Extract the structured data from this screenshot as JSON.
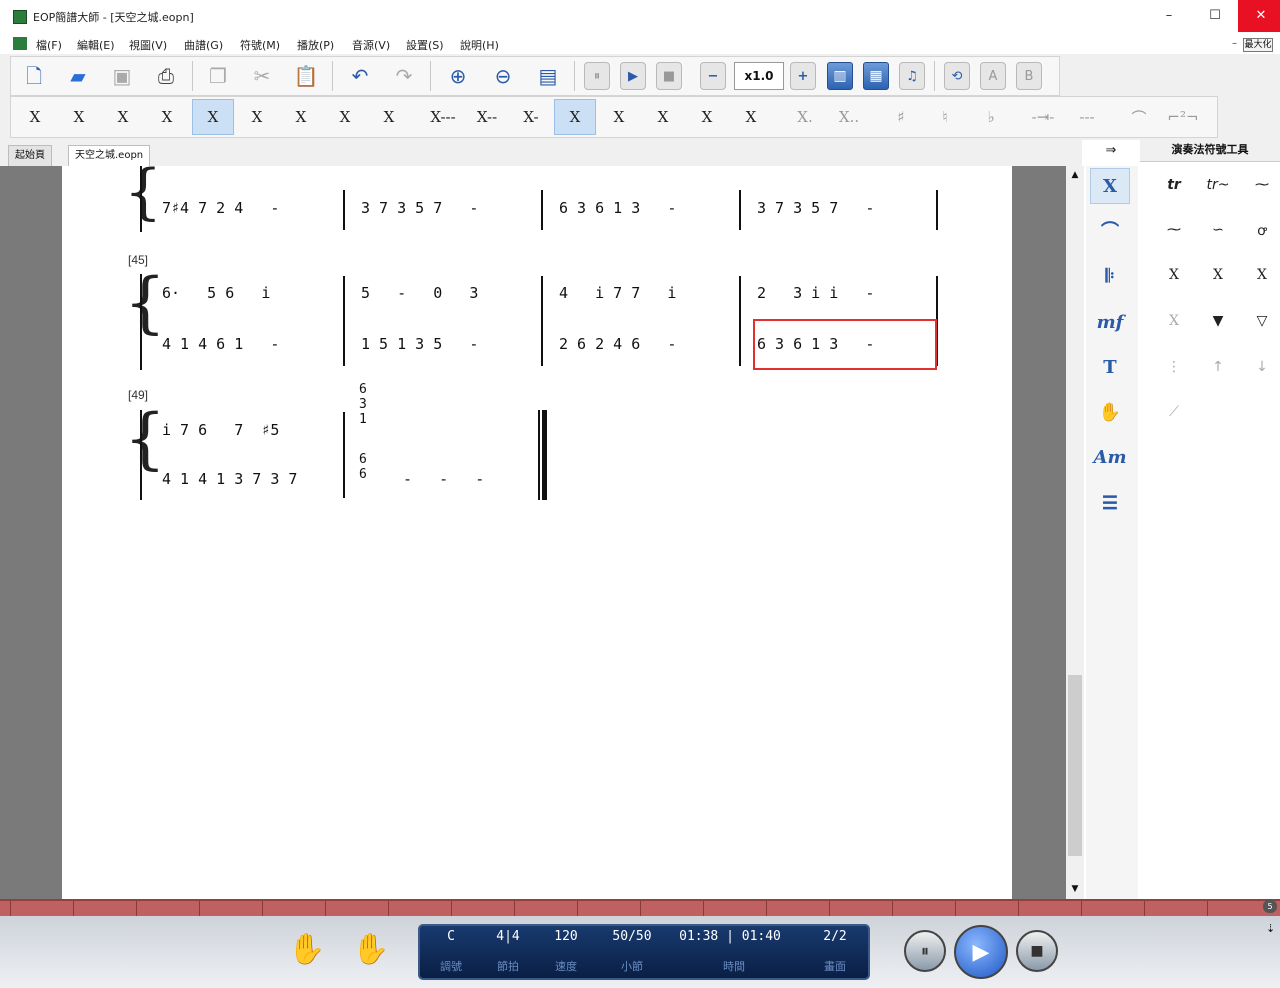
{
  "window": {
    "title": "EOP簡譜大師 - [天空之城.eopn]",
    "minimize": "–",
    "maximize": "☐",
    "close": "✕"
  },
  "menu": {
    "items": [
      "檔(F)",
      "編輯(E)",
      "視圖(V)",
      "曲譜(G)",
      "符號(M)",
      "播放(P)",
      "音源(V)",
      "設置(S)",
      "說明(H)"
    ],
    "mdi_max_label": "最大化"
  },
  "toolbar": {
    "speed": "x1.0",
    "minus": "−",
    "plus": "+",
    "letter_a": "A",
    "letter_b": "B"
  },
  "notetoolbar": {
    "items": [
      "X",
      "X",
      "X",
      "X",
      "X",
      "X",
      "X",
      "X",
      "X",
      "X---",
      "X--",
      "X-",
      "X",
      "X",
      "X",
      "X",
      "X",
      "X.",
      "X..",
      "♯",
      "♮",
      "♭",
      "-⇥-",
      "---",
      "⌒",
      "⌐²¬"
    ]
  },
  "tabs": [
    {
      "label": "起始頁"
    },
    {
      "label": "天空之城.eopn"
    }
  ],
  "sidebar": {
    "header": "演奏法符號工具",
    "arrow": "⇒",
    "tools": [
      "X",
      "⌒",
      "𝄆",
      "mf",
      "T",
      "✋",
      "Am",
      "☰"
    ],
    "ornaments": [
      "tr",
      "tr~",
      "⁓",
      "⁓",
      "∽",
      "ꝍ",
      "X",
      "X",
      "X",
      "X",
      "▼",
      "▽",
      "⋮",
      "↑",
      "↓",
      "⟋"
    ]
  },
  "score": {
    "measure_numbers": [
      "[45]",
      "[49]"
    ],
    "sys1": {
      "row2": [
        "7♯4 7 2 4   -",
        "3 7 3 5 7   -",
        "6 3 6 1 3   -",
        "3 7 3 5 7   -"
      ]
    },
    "sys2": {
      "row1": [
        "6·   5 6   i",
        "5   -   0   3",
        "4   i 7 7   i",
        "2   3 i i   -"
      ],
      "row2": [
        "4 1 4 6 1   -",
        "1 5 1 3 5   -",
        "2 6 2 4 6   -",
        "6 3 6 1 3   -"
      ]
    },
    "sys3": {
      "row1": [
        "i 7 6   7  ♯5"
      ],
      "row2": [
        "4 1 4 1 3 7 3 7"
      ],
      "chord": "6\n3\n1",
      "bass": "6\n6",
      "dashes": "-   -   -"
    }
  },
  "status": {
    "key": "C",
    "key_label": "調號",
    "meter": "4|4",
    "meter_label": "節拍",
    "tempo": "120",
    "tempo_label": "速度",
    "measure": "50/50",
    "measure_label": "小節",
    "time": "01:38 | 01:40",
    "time_label": "時間",
    "page": "2/2",
    "page_label": "畫面"
  },
  "ruler": {
    "badge": "5"
  },
  "colors": {
    "accent": "#2a5aa8",
    "close": "#e81123",
    "ruler": "#c06060",
    "selection": "#e03030"
  }
}
